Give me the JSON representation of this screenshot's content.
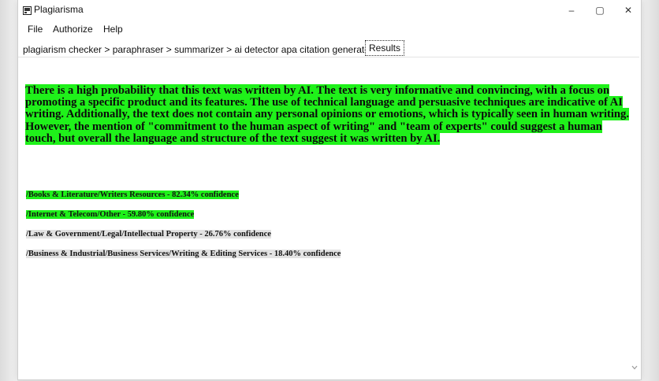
{
  "window": {
    "title": "Plagiarisma",
    "controls": {
      "minimize": "–",
      "maximize": "▢",
      "close": "✕"
    }
  },
  "menu": {
    "items": [
      "File",
      "Authorize",
      "Help"
    ]
  },
  "toolbar": {
    "breadcrumb": "plagiarism checker > paraphraser > summarizer > ai detector  apa citation generator",
    "results_tab": "Results"
  },
  "results": {
    "verdict": "There is a high probability that this text was written by AI. The text is very informative and convincing, with a focus on promoting a specific product and its features. The use of technical language and persuasive techniques are indicative of AI writing. Additionally, the text does not contain any personal opinions or emotions, which is typically seen in human writing. However, the mention of \"commitment to the human aspect of writing\" and \"team of experts\" could suggest a human touch, but overall the language and structure of the text suggest it was written by AI.",
    "categories": [
      {
        "label": "/Books & Literature/Writers Resources - 82.34% confidence",
        "highlight": "#1ff11a"
      },
      {
        "label": "/Internet & Telecom/Other - 59.80% confidence",
        "highlight": "#1ff11a"
      },
      {
        "label": "/Law & Government/Legal/Intellectual Property - 26.76% confidence",
        "highlight": "#e3e3e3"
      },
      {
        "label": "/Business & Industrial/Business Services/Writing & Editing Services - 18.40% confidence",
        "highlight": "#e3e3e3"
      }
    ]
  },
  "colors": {
    "highlight_high": "#1ff11a",
    "highlight_low": "#e3e3e3"
  },
  "icons": {
    "app": "app-window-icon",
    "scroll": "chevron-down-icon"
  }
}
